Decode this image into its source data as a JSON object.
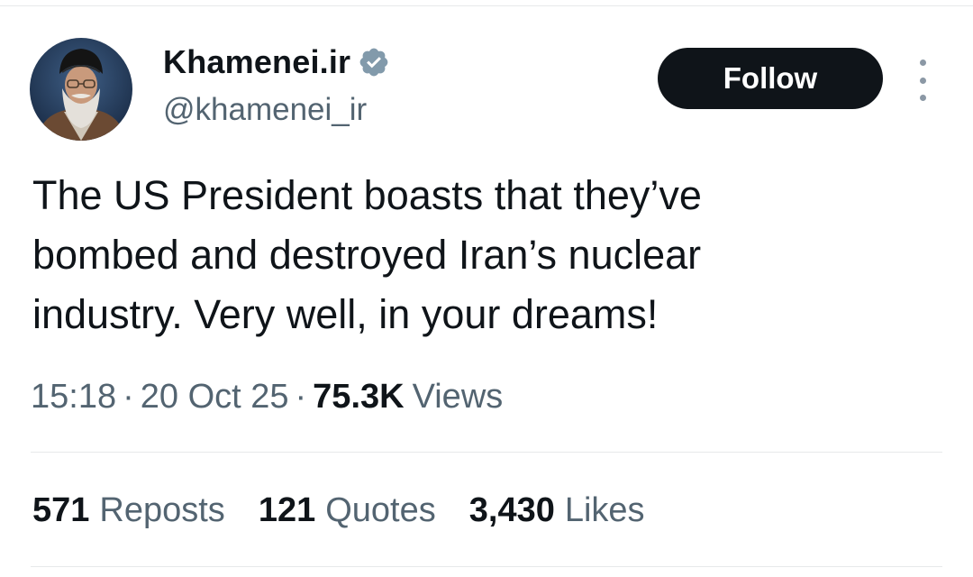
{
  "author": {
    "display_name": "Khamenei.ir",
    "handle": "@khamenei_ir",
    "verified": true,
    "verified_color": "#829aab"
  },
  "follow_button": {
    "label": "Follow"
  },
  "more_menu": {
    "icon": "more-vertical-icon"
  },
  "tweet": {
    "text_lines": [
      "The US President boasts that they’ve",
      "bombed and destroyed Iran’s nuclear",
      "industry. Very well, in your dreams!"
    ]
  },
  "meta": {
    "time": "15:18",
    "date": "20 Oct 25",
    "separator": "·",
    "views_count": "75.3K",
    "views_label": "Views"
  },
  "stats": {
    "reposts": {
      "count": "571",
      "label": "Reposts"
    },
    "quotes": {
      "count": "121",
      "label": "Quotes"
    },
    "likes": {
      "count": "3,430",
      "label": "Likes"
    }
  },
  "colors": {
    "text_primary": "#0f1419",
    "text_secondary": "#536471",
    "divider": "#e7e9ea",
    "follow_bg": "#0f1419",
    "follow_text": "#ffffff"
  }
}
